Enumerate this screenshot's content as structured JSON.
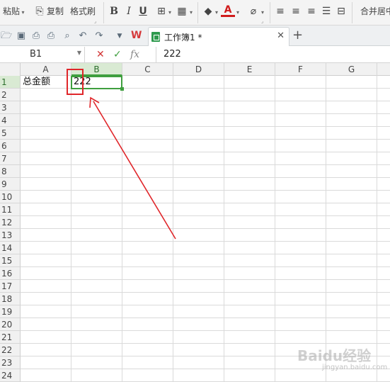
{
  "ribbon": {
    "paste_label": "粘贴",
    "copy_label": "复制",
    "format_painter_label": "格式刷",
    "bold_label": "B",
    "italic_label": "I",
    "underline_label": "U",
    "font_color_label": "A",
    "merge_center_label": "合并居中"
  },
  "tabs": {
    "doc_title": "工作簿1 *"
  },
  "formula_bar": {
    "name_box": "B1",
    "fx_label": "fx",
    "value": "222"
  },
  "grid": {
    "columns": [
      "A",
      "B",
      "C",
      "D",
      "E",
      "F",
      "G"
    ],
    "rows": [
      "1",
      "2",
      "3",
      "4",
      "5",
      "6",
      "7",
      "8",
      "9",
      "10",
      "11",
      "12",
      "13",
      "14",
      "15",
      "16",
      "17",
      "18",
      "19",
      "20",
      "21",
      "22",
      "23",
      "24"
    ],
    "active_cell": "B1",
    "cells": {
      "A1": "总金额",
      "B1": "222"
    }
  },
  "watermark": {
    "text": "Baidu经验",
    "sub": "jingyan.baidu.com"
  },
  "colors": {
    "accent_green": "#3f9f3f",
    "annotation_red": "#e0262a"
  }
}
